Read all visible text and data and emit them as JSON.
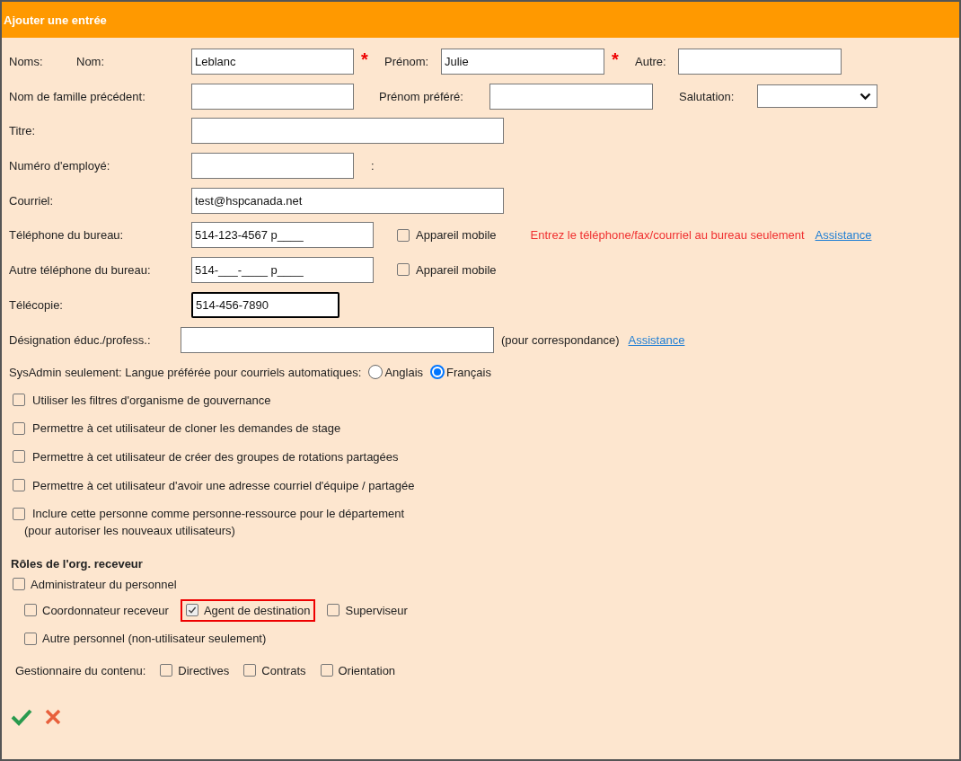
{
  "window": {
    "title": "Ajouter une entrée"
  },
  "names": {
    "label": "Noms:",
    "fields": [
      {
        "label": "Nom:",
        "value": "Leblanc",
        "required_mark": "*"
      },
      {
        "label": "Prénom:",
        "value": "Julie",
        "required_mark": "*"
      },
      {
        "label": "Autre:"
      }
    ]
  },
  "previous_name": {
    "label": "Nom de famille précédent:"
  },
  "preferred_first_name": {
    "label": "Prénom préféré:"
  },
  "salutation": {
    "label": "Salutation:"
  },
  "title_field": {
    "label": "Titre:"
  },
  "employee_number": {
    "label": "Numéro d'employé:",
    "suffix": ":"
  },
  "email": {
    "label": "Courriel:",
    "value": "test@hspcanada.net"
  },
  "phones": [
    {
      "label": "Téléphone du bureau:",
      "value": "514-123-4567 p____",
      "mobile_label": "Appareil mobile",
      "mobile_checked": false,
      "note": "Entrez le téléphone/fax/courriel au bureau seulement",
      "help_link": "Assistance"
    },
    {
      "label": "Autre téléphone du bureau:",
      "value": "514-___-____ p____",
      "mobile_label": "Appareil mobile",
      "mobile_checked": false
    }
  ],
  "fax": {
    "label": "Télécopie:",
    "value": "514-456-7890",
    "focused": true
  },
  "designation": {
    "label": "Désignation éduc./profess.:",
    "note": "(pour correspondance)",
    "help_link": "Assistance"
  },
  "language": {
    "label": "SysAdmin seulement: Langue préférée pour courriels automatiques:",
    "options": [
      {
        "label": "Anglais",
        "selected": false
      },
      {
        "label": "Français",
        "selected": true
      }
    ]
  },
  "permissions": [
    {
      "label": "Utiliser les filtres d'organisme de gouvernance",
      "checked": false
    },
    {
      "label": "Permettre à cet utilisateur de cloner les demandes de stage",
      "checked": false
    },
    {
      "label": "Permettre à cet utilisateur de créer des groupes de rotations partagées",
      "checked": false
    },
    {
      "label": "Permettre à cet utilisateur d'avoir une adresse courriel d'équipe / partagée",
      "checked": false
    },
    {
      "label": "Inclure cette personne comme personne-ressource pour le département",
      "sub_label": "(pour autoriser les nouveaux utilisateurs)",
      "checked": false
    }
  ],
  "roles": {
    "title": "Rôles de l'org. receveur",
    "rows": [
      {
        "items": [
          {
            "label": "Administrateur du personnel",
            "checked": false,
            "highlighted": false
          }
        ]
      },
      {
        "items": [
          {
            "label": "Coordonnateur receveur",
            "checked": false,
            "highlighted": false
          },
          {
            "label": "Agent de destination",
            "checked": true,
            "highlighted": true
          },
          {
            "label": "Superviseur",
            "checked": false,
            "highlighted": false
          }
        ]
      },
      {
        "items": [
          {
            "label": "Autre personnel (non-utilisateur seulement)",
            "checked": false,
            "highlighted": false
          }
        ]
      }
    ]
  },
  "content_manager": {
    "label": "Gestionnaire du contenu:",
    "options": [
      {
        "label": "Directives",
        "checked": false
      },
      {
        "label": "Contrats",
        "checked": false
      },
      {
        "label": "Orientation",
        "checked": false
      }
    ]
  }
}
